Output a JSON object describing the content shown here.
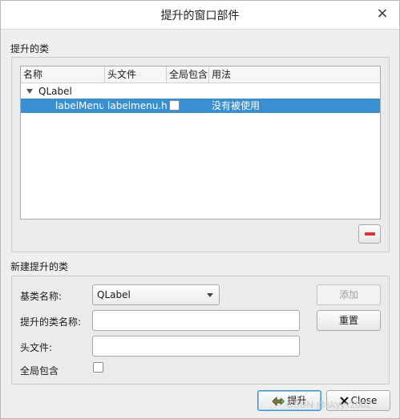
{
  "window": {
    "title": "提升的窗口部件",
    "close_glyph": "×"
  },
  "promoted_section": {
    "label": "提升的类",
    "columns": [
      "名称",
      "头文件",
      "全局包含",
      "用法"
    ],
    "tree": {
      "parent": {
        "name": "QLabel",
        "expanded": true
      },
      "rows": [
        {
          "name": "labelMenu",
          "header": "labelmenu.h",
          "global_include": false,
          "usage": "没有被使用",
          "selected": true
        }
      ]
    }
  },
  "new_section": {
    "label": "新建提升的类",
    "base_class_label": "基类名称:",
    "base_class_value": "QLabel",
    "promoted_class_label": "提升的类名称:",
    "promoted_class_value": "",
    "header_file_label": "头文件:",
    "header_file_value": "",
    "global_include_label": "全局包含",
    "global_include_checked": false,
    "add_button": "添加",
    "reset_button": "重置"
  },
  "footer": {
    "promote_button": "提升",
    "close_button": "Close"
  },
  "watermark": "CSDN @skyyx2002",
  "colors": {
    "selection": "#3a8fd0",
    "remove_icon": "#d7343a"
  }
}
